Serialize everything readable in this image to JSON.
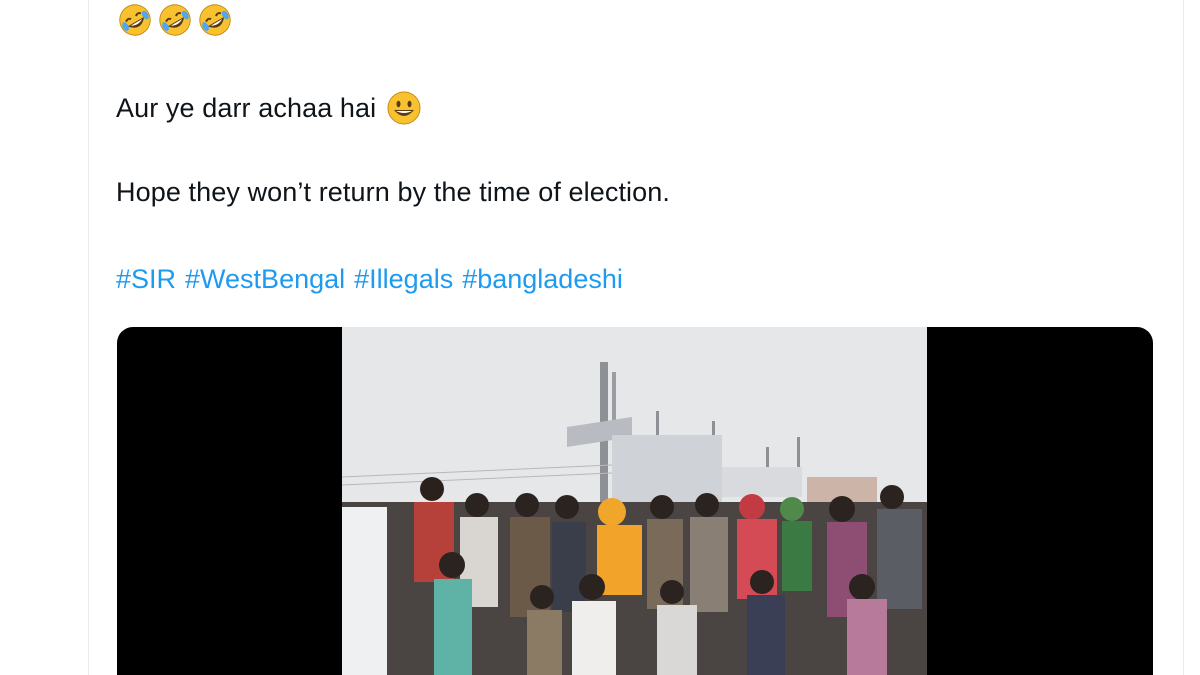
{
  "tweet": {
    "emoji_line": [
      "rolling-on-floor-laughing-icon",
      "rolling-on-floor-laughing-icon",
      "rolling-on-floor-laughing-icon"
    ],
    "line1_text": "Aur ye darr achaa hai",
    "line1_emoji": "grinning-face-icon",
    "line2_text": "Hope they won’t return by the time of election.",
    "hashtags": [
      "#SIR",
      "#WestBengal",
      "#Illegals",
      "#bangladeshi"
    ],
    "colors": {
      "text": "#0f1419",
      "hashtag": "#1d9bf0",
      "media_bg": "#000000"
    }
  },
  "media": {
    "type": "video",
    "thumbnail": "crowd-of-people-outdoors"
  }
}
